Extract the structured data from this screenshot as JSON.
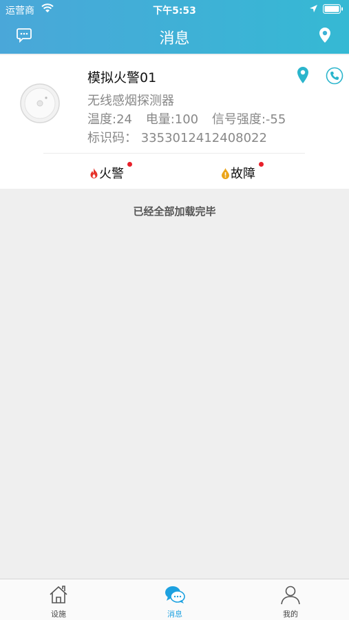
{
  "status_bar": {
    "carrier": "运营商",
    "time": "下午5:53"
  },
  "nav": {
    "title": "消息",
    "left_icon": "chat-bubble-icon",
    "right_icon": "map-pin-icon"
  },
  "card": {
    "name": "模拟火警01",
    "type": "无线感烟探测器",
    "stats": {
      "temperature": "温度:24",
      "battery": "电量:100",
      "signal": "信号强度:-55"
    },
    "code": "标识码： 3353012412408022",
    "tabs": [
      {
        "label": "火警",
        "icon": "flame-icon"
      },
      {
        "label": "故障",
        "icon": "warning-drop-icon"
      }
    ]
  },
  "load_status": "已经全部加载完毕",
  "tabbar": {
    "items": [
      {
        "label": "设施",
        "icon": "home-icon",
        "active": false
      },
      {
        "label": "消息",
        "icon": "message-icon",
        "active": true
      },
      {
        "label": "我的",
        "icon": "user-icon",
        "active": false
      }
    ]
  },
  "colors": {
    "header_start": "#4aa7d9",
    "header_end": "#35b9d4",
    "accent": "#2bb5cc",
    "alert_dot": "#e8202a",
    "active_tab": "#1da1e0"
  }
}
